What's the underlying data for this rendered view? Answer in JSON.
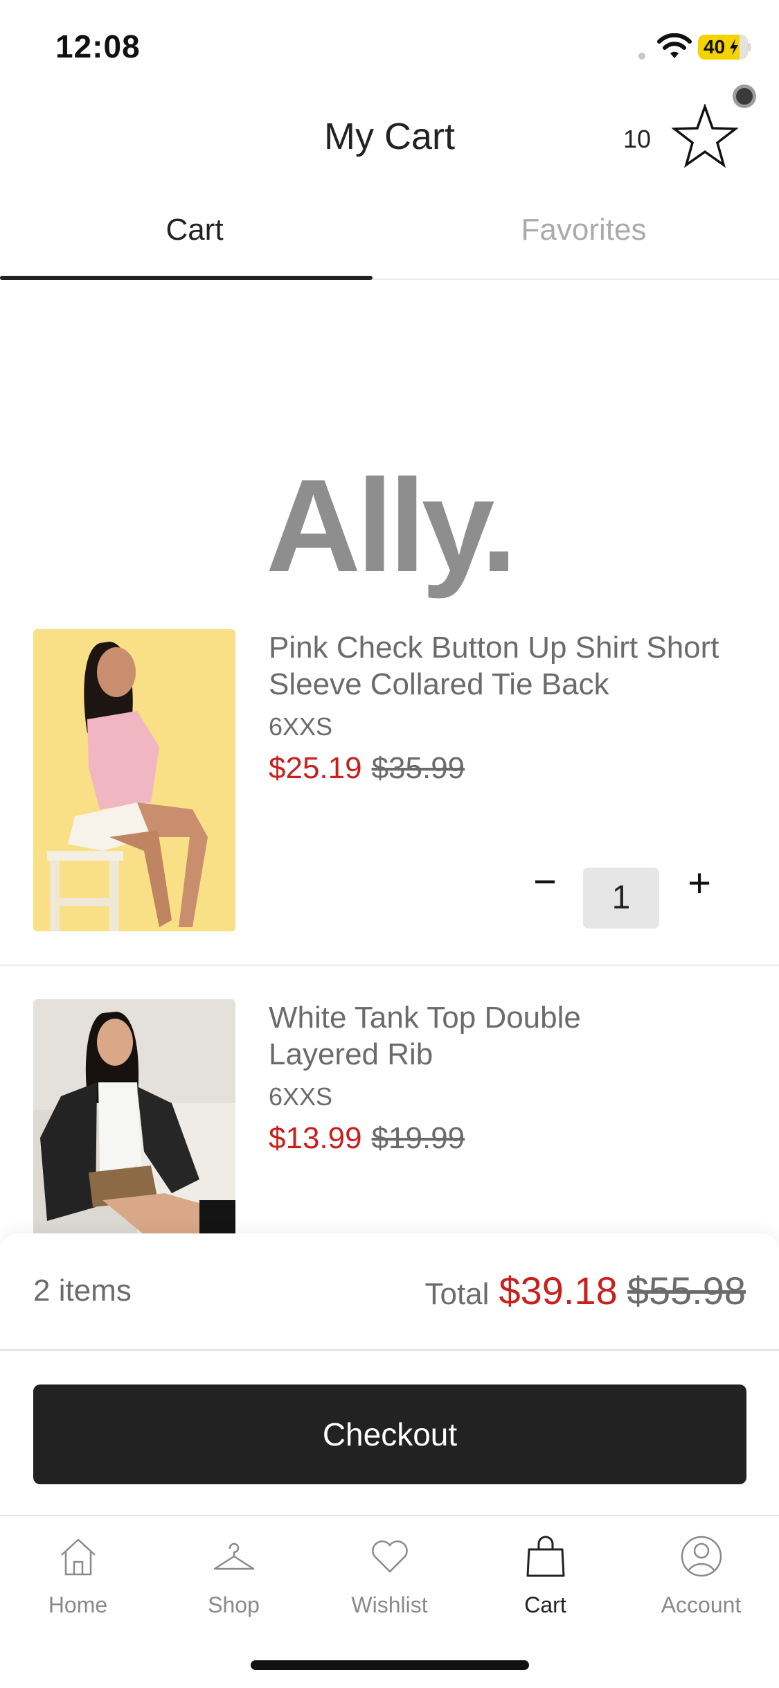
{
  "status_bar": {
    "time": "12:08",
    "battery_level": "40",
    "icons": [
      "wifi-icon",
      "battery-icon",
      "recording-dot"
    ]
  },
  "header": {
    "title": "My Cart",
    "favorites_count": "10",
    "favorites_icon": "star-icon"
  },
  "tabs": [
    {
      "label": "Cart",
      "active": true
    },
    {
      "label": "Favorites",
      "active": false
    }
  ],
  "brand": {
    "logo_text": "Ally."
  },
  "cart_items": [
    {
      "name": "Pink Check Button Up Shirt Short Sleeve Collared Tie Back",
      "size": "6XXS",
      "sale_price": "$25.19",
      "original_price": "$35.99",
      "quantity": "1",
      "qty_minus": "−",
      "qty_plus": "+"
    },
    {
      "name": "White Tank Top Double Layered Rib",
      "size": "6XXS",
      "sale_price": "$13.99",
      "original_price": "$19.99"
    }
  ],
  "summary": {
    "item_count": "2 items",
    "total_label": "Total",
    "total_sale": "$39.18",
    "total_original": "$55.98",
    "checkout_label": "Checkout"
  },
  "bottom_nav": [
    {
      "label": "Home",
      "icon": "home-icon",
      "active": false
    },
    {
      "label": "Shop",
      "icon": "hanger-icon",
      "active": false
    },
    {
      "label": "Wishlist",
      "icon": "heart-icon",
      "active": false
    },
    {
      "label": "Cart",
      "icon": "shopping-bag-icon",
      "active": true
    },
    {
      "label": "Account",
      "icon": "user-icon",
      "active": false
    }
  ],
  "colors": {
    "sale_red": "#c8201c",
    "primary_dark": "#222222",
    "muted_text": "#6b6b6b",
    "battery_yellow": "#f4d300"
  }
}
